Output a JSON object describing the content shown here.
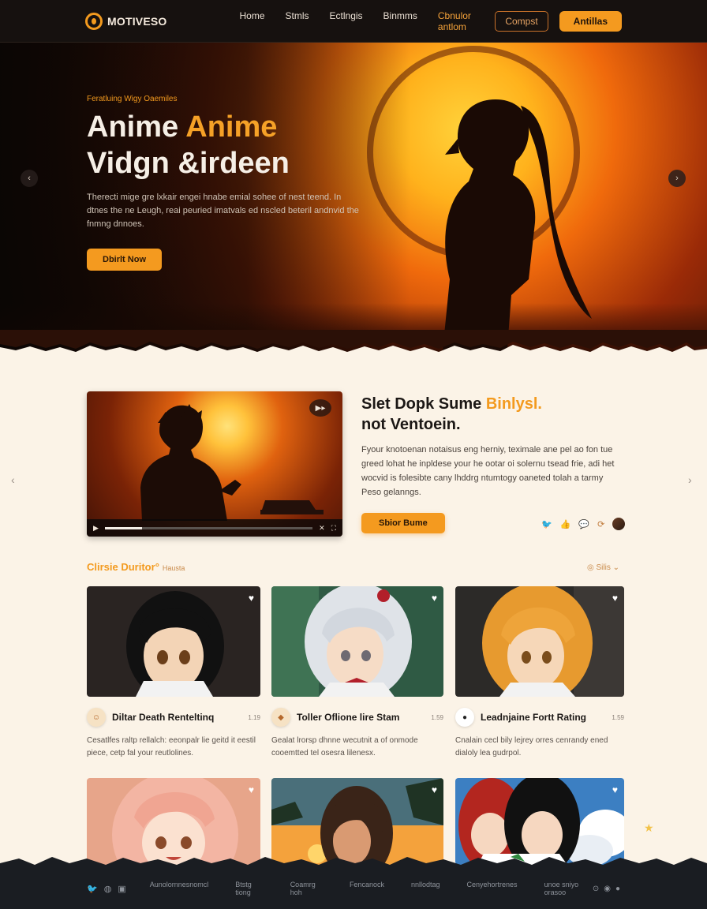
{
  "nav": {
    "logo_text": "MOTIVESO",
    "links": [
      "Home",
      "Stmls",
      "Ectlngis",
      "Binmms",
      "Cbnulor antlom"
    ],
    "login_label": "Compst",
    "cta_label": "Antillas",
    "icon": "logo-mark"
  },
  "hero": {
    "eyebrow": "Feratluing Wigy Oaemiles",
    "title_line1_a": "Anime ",
    "title_line1_b": "Anime",
    "title_line2": "Vidgn &irdeen",
    "description": "Therecti mige gre lxkair engei hnabe emial sohee of nest teend. In dtnes the ne Leugh, reai peuried imatvals ed nscled beteril andnvid the fnmng dnnoes.",
    "button_label": "Dbirlt Now",
    "prev_icon": "chevron-left-icon",
    "next_icon": "chevron-right-icon"
  },
  "feature": {
    "title_a": "Slet Dopk Sume ",
    "title_b": "Binlysl.",
    "title_line2": "not Ventoein.",
    "description": "Fyour knotoenan notaisus eng herniy, teximale ane pel ao fon tue greed lohat he inpldese your he ootar oi solernu tsead frie, adi het wocvid is folesibte cany lhddrg ntumtogy oaneted tolah a tarmy Peso gelanngs.",
    "button_label": "Sbior Bume",
    "video_badge": "▶▸",
    "social_icons": [
      "twitter-icon",
      "like-icon",
      "chat-icon",
      "share-icon"
    ]
  },
  "gallery": {
    "section_title": "Clirsie Duritor",
    "section_sup": "°",
    "section_sub": "Hausta",
    "sort_label": "◎ Silis ⌄",
    "cards": [
      {
        "title": "Diltar Death Renteltinq",
        "count": "1.19",
        "desc": "Cesatlfes raltp rellalch: eeonpalr lie geitd it eestil piece, cetp fal your reutlolines."
      },
      {
        "title": "Toller Oflione lire Stam",
        "count": "1.59",
        "desc": "Gealat lrorsp dhnne wecutnit a of onmode cooemtted tel osesra lilenesx."
      },
      {
        "title": "Leadnjaine Fortt Rating",
        "count": "1.59",
        "desc": "Cnalain cecl bily lejrey orres cenrandy ened dialoly lea gudrpol."
      }
    ]
  },
  "footer": {
    "links": [
      "Aunolornnesnomcl",
      "Btstg tiong",
      "Coamrg hoh",
      "Fencanock",
      "nnllodtag",
      "Cenyehortrenes",
      "unoe sniyo orasoo"
    ]
  },
  "colors": {
    "accent": "#f49a1f",
    "background": "#fbf3e7",
    "nav": "#16110f",
    "footer": "#1a1d22"
  }
}
